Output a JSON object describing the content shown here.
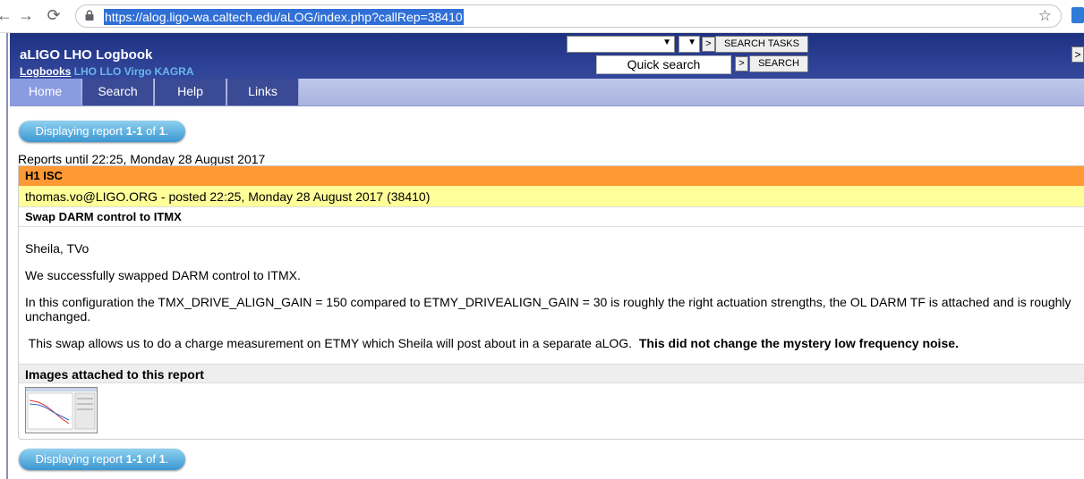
{
  "browser": {
    "back": "←",
    "forward": "→",
    "reload": "⟳",
    "url": "https://alog.ligo-wa.caltech.edu/aLOG/index.php?callRep=38410",
    "star": "☆"
  },
  "header": {
    "title": "aLIGO LHO Logbook",
    "logbooks_label": "Logbooks",
    "logbook_links": [
      "LHO",
      "LLO",
      "Virgo",
      "KAGRA"
    ],
    "search_tasks_label": "SEARCH TASKS",
    "quick_search_placeholder": "Quick search",
    "search_label": "SEARCH",
    "go_glyph": ">",
    "dropdown_glyph": "▼",
    "edge_glyph": ">"
  },
  "menu": [
    {
      "label": "Home",
      "active": true
    },
    {
      "label": "Search",
      "active": false
    },
    {
      "label": "Help",
      "active": false
    },
    {
      "label": "Links",
      "active": false
    }
  ],
  "pager": {
    "prefix": "Displaying report ",
    "range": "1-1",
    "mid": " of ",
    "total": "1",
    "suffix": "."
  },
  "reports_until": "Reports until 22:25, Monday 28 August 2017",
  "report": {
    "category": "H1 ISC",
    "author_line": "thomas.vo@LIGO.ORG - posted 22:25, Monday 28 August 2017 (38410)",
    "title": "Swap DARM control to ITMX",
    "para1": "Sheila, TVo",
    "para2": "We successfully swapped DARM control to ITMX.",
    "para3": "In this configuration the TMX_DRIVE_ALIGN_GAIN = 150 compared to ETMY_DRIVEALIGN_GAIN = 30 is roughly the right actuation strengths, the OL DARM TF is attached and is roughly unchanged.",
    "para4_normal": " This swap allows us to do a charge measurement on ETMY which Sheila will post about in a separate aLOG.  ",
    "para4_bold": "This did not change the mystery low frequency noise.",
    "images_heading": "Images attached to this report"
  },
  "colors": {
    "header_bg": "#2b3f93",
    "menu_active": "#8a9be0",
    "category_bg": "#ff9933",
    "author_bg": "#ffff99",
    "pill": "#3a97d2"
  }
}
